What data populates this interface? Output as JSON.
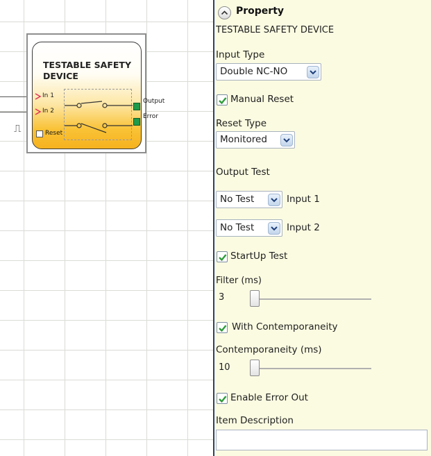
{
  "block": {
    "title": "TESTABLE SAFETY DEVICE",
    "inputs": [
      "In 1",
      "In 2"
    ],
    "reset_label": "Reset",
    "outputs": [
      "Output",
      "Error"
    ]
  },
  "panel": {
    "header": "Property",
    "subtitle": "TESTABLE SAFETY DEVICE",
    "input_type": {
      "label": "Input Type",
      "value": "Double NC-NO"
    },
    "manual_reset": {
      "label": "Manual Reset",
      "checked": true
    },
    "reset_type": {
      "label": "Reset Type",
      "value": "Monitored"
    },
    "output_test": {
      "label": "Output Test",
      "rows": [
        {
          "value": "No Test",
          "label": "Input 1"
        },
        {
          "value": "No Test",
          "label": "Input 2"
        }
      ]
    },
    "startup_test": {
      "label": "StartUp Test",
      "checked": true
    },
    "filter": {
      "label": "Filter (ms)",
      "value": "3"
    },
    "with_contemporaneity": {
      "label": "With Contemporaneity",
      "checked": true
    },
    "contemporaneity": {
      "label": "Contemporaneity (ms)",
      "value": "10"
    },
    "enable_error_out": {
      "label": "Enable Error Out",
      "checked": true
    },
    "item_description": {
      "label": "Item Description",
      "value": ""
    }
  },
  "colors": {
    "panel_bg": "#fbfbe2",
    "block_gradient_bottom": "#f6b21e",
    "pin_green": "#1e9a4a",
    "check_green": "#2e9b3a",
    "input_pin_red": "#e0305a"
  },
  "icons": [
    "collapse-chevron-icon",
    "checkmark-icon",
    "dropdown-chevron-icon",
    "pulse-icon"
  ]
}
